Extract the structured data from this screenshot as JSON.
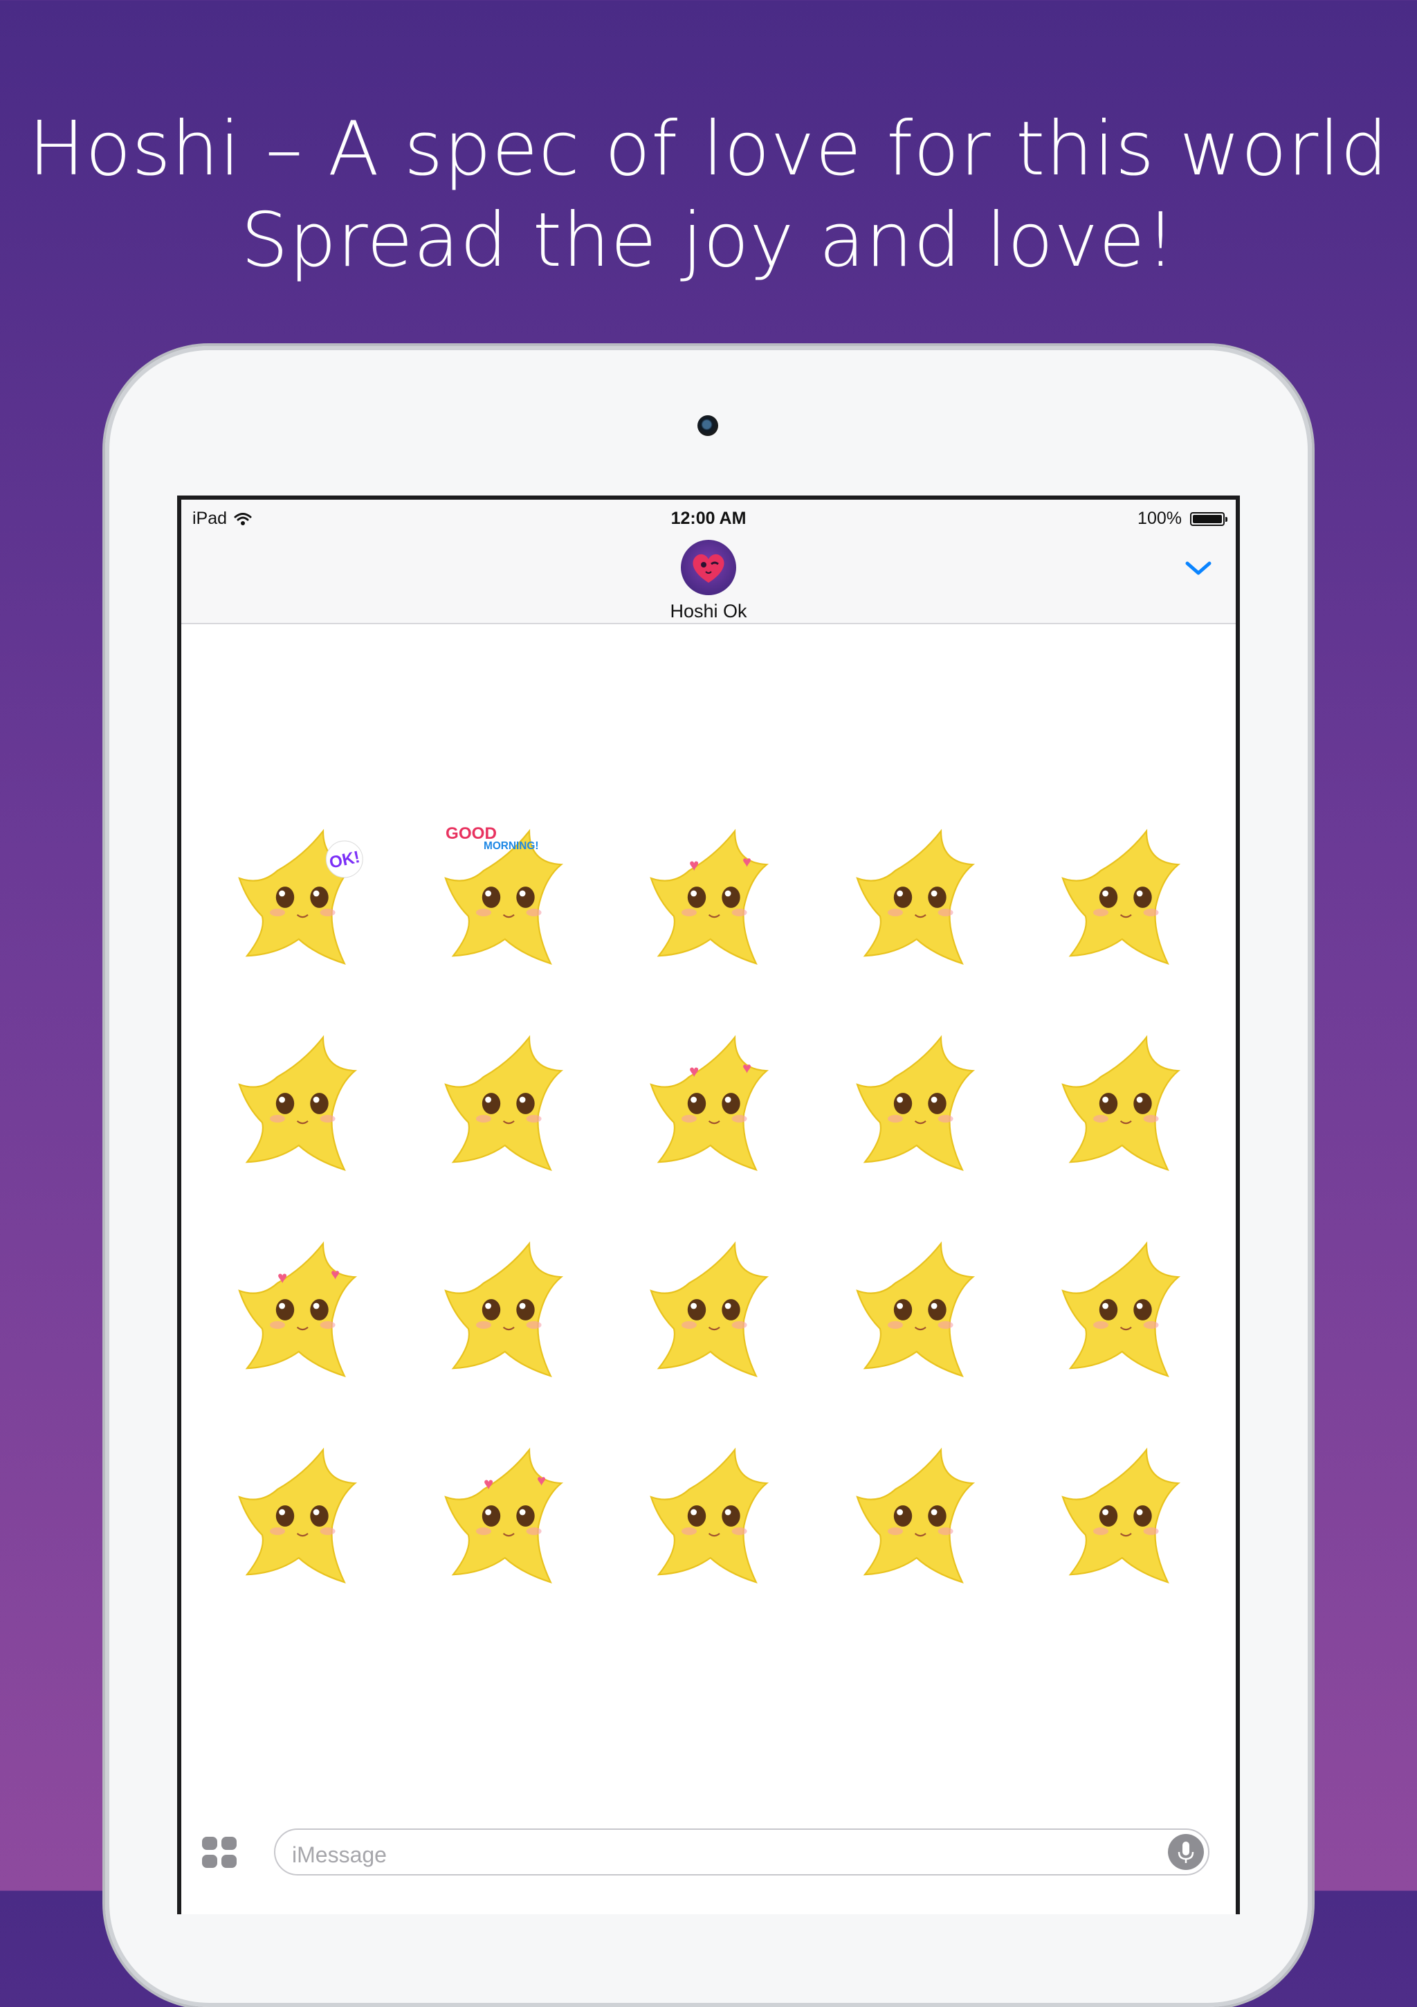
{
  "headline": {
    "line1": "Hoshi – A spec of love for this world",
    "line2": "Spread the joy and love!"
  },
  "status_bar": {
    "device": "iPad",
    "time": "12:00 AM",
    "battery": "100%"
  },
  "conversation": {
    "contact_name": "Hoshi Ok"
  },
  "stickers": [
    {
      "name": "ok-wink",
      "text": "OK!"
    },
    {
      "name": "good-morning",
      "text": "GOOD MORNING!"
    },
    {
      "name": "hearts-love",
      "text": ""
    },
    {
      "name": "confused",
      "text": ""
    },
    {
      "name": "happy-squint",
      "text": ""
    },
    {
      "name": "smile",
      "text": ""
    },
    {
      "name": "open-smile",
      "text": ""
    },
    {
      "name": "hearts-shy",
      "text": ""
    },
    {
      "name": "worried",
      "text": ""
    },
    {
      "name": "shaking",
      "text": ""
    },
    {
      "name": "in-love",
      "text": ""
    },
    {
      "name": "content",
      "text": ""
    },
    {
      "name": "neutral",
      "text": ""
    },
    {
      "name": "shh",
      "text": ""
    },
    {
      "name": "sleepy",
      "text": ""
    },
    {
      "name": "calm",
      "text": ""
    },
    {
      "name": "heart-eyes",
      "text": ""
    },
    {
      "name": "surprised",
      "text": ""
    },
    {
      "name": "teary",
      "text": ""
    },
    {
      "name": "sad",
      "text": ""
    }
  ],
  "input": {
    "placeholder": "iMessage"
  },
  "colors": {
    "background_top": "#4a2b86",
    "background_bottom": "#8e4a9e",
    "accent_blue": "#0a84ff",
    "star_yellow": "#f7d940"
  }
}
